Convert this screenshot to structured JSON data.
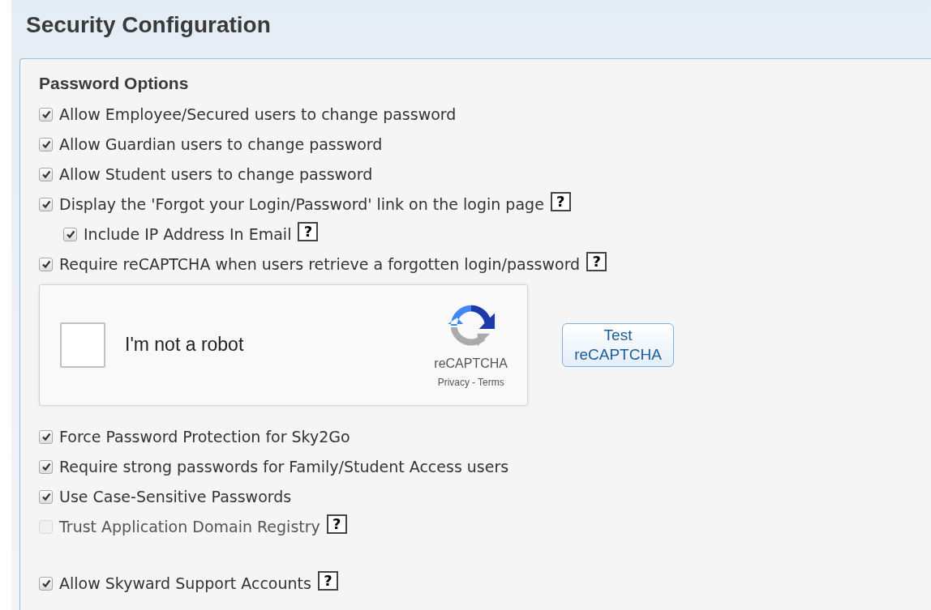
{
  "page_title": "Security Configuration",
  "section_title": "Password Options",
  "options": [
    {
      "kind": "checkbox",
      "label": "Allow Employee/Secured users to change password",
      "checked": true,
      "disabled": false
    },
    {
      "kind": "checkbox",
      "label": "Allow Guardian users to change password",
      "checked": true,
      "disabled": false
    },
    {
      "kind": "checkbox",
      "label": "Allow Student users to change password",
      "checked": true,
      "disabled": false
    },
    {
      "kind": "checkbox",
      "label": "Display the 'Forgot your Login/Password' link on the login page",
      "checked": true,
      "disabled": false,
      "help_text": "?",
      "children": [
        {
          "kind": "checkbox",
          "label": "Include IP Address In Email",
          "checked": true,
          "disabled": false,
          "help_text": "?"
        }
      ]
    },
    {
      "kind": "checkbox",
      "label": "Require reCAPTCHA when users retrieve a forgotten login/password",
      "checked": true,
      "disabled": false,
      "help_text": "?"
    },
    {
      "kind": "recaptcha",
      "label": "I'm not a robot",
      "checked": false,
      "brand": "reCAPTCHA",
      "privacy": "Privacy",
      "separator": "-",
      "terms": "Terms",
      "button": "Test reCAPTCHA"
    },
    {
      "kind": "checkbox",
      "label": "Force Password Protection for Sky2Go",
      "checked": true,
      "disabled": false
    },
    {
      "kind": "checkbox",
      "label": "Require strong passwords for Family/Student Access users",
      "checked": true,
      "disabled": false
    },
    {
      "kind": "checkbox",
      "label": "Use Case-Sensitive Passwords",
      "checked": true,
      "disabled": false
    },
    {
      "kind": "checkbox",
      "label": "Trust Application Domain Registry",
      "checked": false,
      "disabled": true,
      "help_text": "?"
    }
  ],
  "support_options": [
    {
      "kind": "checkbox",
      "label": "Allow Skyward Support Accounts",
      "checked": true,
      "disabled": false,
      "help_text": "?"
    }
  ]
}
